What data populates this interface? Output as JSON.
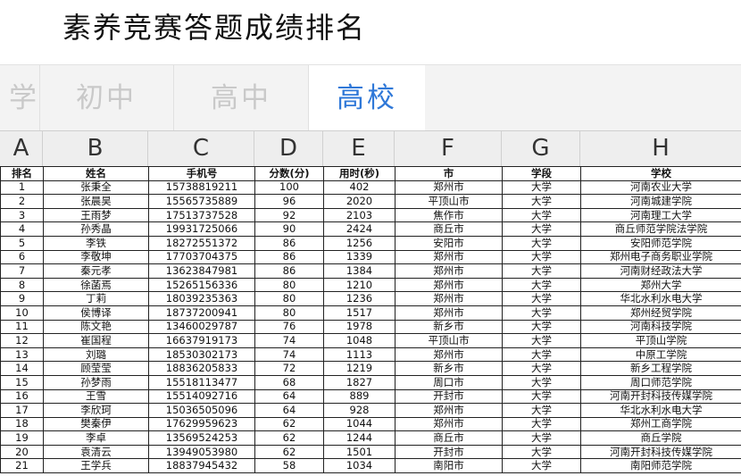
{
  "title": "素养竞赛答题成绩排名",
  "tabs": [
    {
      "label": "学",
      "active": false
    },
    {
      "label": "初中",
      "active": false
    },
    {
      "label": "高中",
      "active": false
    },
    {
      "label": "高校",
      "active": true
    }
  ],
  "accent_color": "#2f78d8",
  "column_letters": [
    "A",
    "B",
    "C",
    "D",
    "E",
    "F",
    "G",
    "H"
  ],
  "table": {
    "headers": [
      "排名",
      "姓名",
      "手机号",
      "分数(分)",
      "用时(秒)",
      "市",
      "学段",
      "学校"
    ],
    "rows": [
      [
        "1",
        "张秉全",
        "15738819211",
        "100",
        "402",
        "郑州市",
        "大学",
        "河南农业大学"
      ],
      [
        "2",
        "张晨昊",
        "15565735889",
        "96",
        "2020",
        "平顶山市",
        "大学",
        "河南城建学院"
      ],
      [
        "3",
        "王雨梦",
        "17513737528",
        "92",
        "2103",
        "焦作市",
        "大学",
        "河南理工大学"
      ],
      [
        "4",
        "孙秀晶",
        "19931725066",
        "90",
        "2424",
        "商丘市",
        "大学",
        "商丘师范学院法学院"
      ],
      [
        "5",
        "李铁",
        "18272551372",
        "86",
        "1256",
        "安阳市",
        "大学",
        "安阳师范学院"
      ],
      [
        "6",
        "李敬坤",
        "17703704375",
        "86",
        "1339",
        "郑州市",
        "大学",
        "郑州电子商务职业学院"
      ],
      [
        "7",
        "秦元孝",
        "13623847981",
        "86",
        "1384",
        "郑州市",
        "大学",
        "河南财经政法大学"
      ],
      [
        "8",
        "徐菡焉",
        "15265156336",
        "80",
        "1210",
        "郑州市",
        "大学",
        "郑州大学"
      ],
      [
        "9",
        "丁莉",
        "18039235363",
        "80",
        "1236",
        "郑州市",
        "大学",
        "华北水利水电大学"
      ],
      [
        "10",
        "侯博译",
        "18737200941",
        "80",
        "1517",
        "郑州市",
        "大学",
        "郑州经贸学院"
      ],
      [
        "11",
        "陈文艳",
        "13460029787",
        "76",
        "1978",
        "新乡市",
        "大学",
        "河南科技学院"
      ],
      [
        "12",
        "崔国程",
        "16637919173",
        "74",
        "1048",
        "平顶山市",
        "大学",
        "平顶山学院"
      ],
      [
        "13",
        "刘璐",
        "18530302173",
        "74",
        "1113",
        "郑州市",
        "大学",
        "中原工学院"
      ],
      [
        "14",
        "顾莹莹",
        "18836205833",
        "72",
        "1219",
        "新乡市",
        "大学",
        "新乡工程学院"
      ],
      [
        "15",
        "孙梦雨",
        "15518113477",
        "68",
        "1827",
        "周口市",
        "大学",
        "周口师范学院"
      ],
      [
        "16",
        "王雪",
        "15514092716",
        "64",
        "889",
        "开封市",
        "大学",
        "河南开封科技传媒学院"
      ],
      [
        "17",
        "李欣珂",
        "15036505096",
        "64",
        "928",
        "郑州市",
        "大学",
        "华北水利水电大学"
      ],
      [
        "18",
        "樊秦伊",
        "17629959623",
        "62",
        "1044",
        "郑州市",
        "大学",
        "郑州工商学院"
      ],
      [
        "19",
        "李卓",
        "13569524253",
        "62",
        "1244",
        "商丘市",
        "大学",
        "商丘学院"
      ],
      [
        "20",
        "袁清云",
        "13949053980",
        "62",
        "1501",
        "开封市",
        "大学",
        "河南开封科技传媒学院"
      ],
      [
        "21",
        "王学兵",
        "18837945432",
        "58",
        "1034",
        "南阳市",
        "大学",
        "南阳师范学院"
      ]
    ]
  }
}
